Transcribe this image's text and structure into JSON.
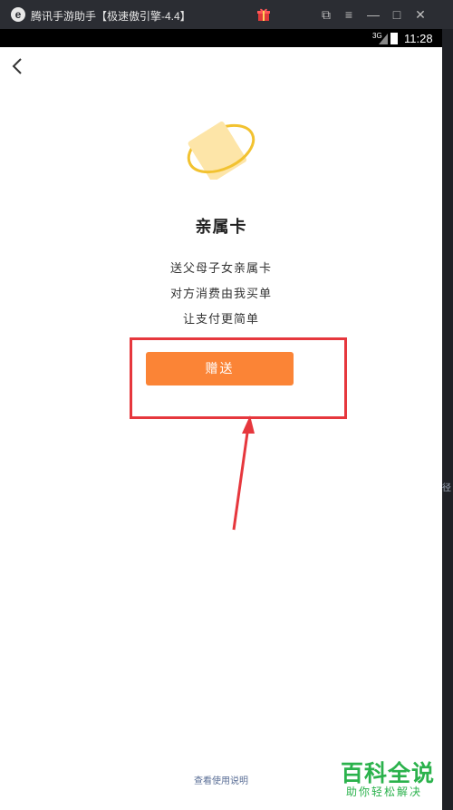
{
  "window": {
    "title": "腾讯手游助手【极速傲引擎-4.4】",
    "logo_glyph": "e"
  },
  "window_controls": {
    "pin_icon": "⧉",
    "menu_icon": "≡",
    "minimize_icon": "—",
    "maximize_icon": "□",
    "close_icon": "✕"
  },
  "status_bar": {
    "network": "3G",
    "time": "11:28"
  },
  "side_strip_text": "简径",
  "page": {
    "title": "亲属卡",
    "lines": [
      "送父母子女亲属卡",
      "对方消费由我买单",
      "让支付更简单"
    ],
    "gift_button": "赠送",
    "help_link": "查看使用说明"
  },
  "colors": {
    "accent_button": "#fb8436",
    "annotation_red": "#e6373d",
    "link_blue": "#5a6e96",
    "watermark_green": "#2bb24c"
  },
  "watermark": {
    "top": "百科全说",
    "bottom": "助你轻松解决"
  }
}
